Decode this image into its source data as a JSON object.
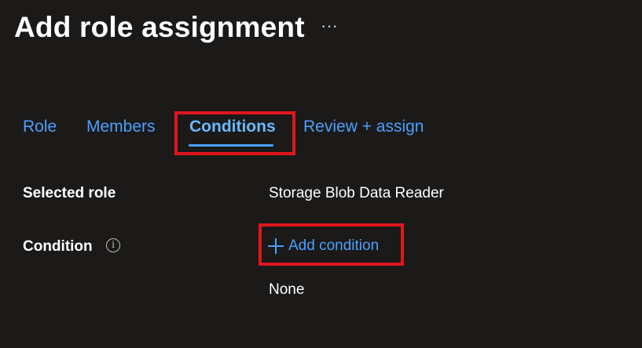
{
  "header": {
    "title": "Add role assignment",
    "more_label": "···"
  },
  "tabs": [
    {
      "label": "Role",
      "selected": false
    },
    {
      "label": "Members",
      "selected": false
    },
    {
      "label": "Conditions",
      "selected": true
    },
    {
      "label": "Review + assign",
      "selected": false
    }
  ],
  "form": {
    "selected_role_label": "Selected role",
    "selected_role_value": "Storage Blob Data Reader",
    "condition_label": "Condition",
    "info_icon_glyph": "i",
    "add_condition_label": "Add condition",
    "condition_value": "None"
  },
  "colors": {
    "background": "#1b1a19",
    "link": "#4aa0ff",
    "highlight": "#e0161e",
    "text": "#ffffff"
  },
  "icons": {
    "more": "more-icon",
    "info": "info-icon",
    "add": "plus-icon"
  }
}
